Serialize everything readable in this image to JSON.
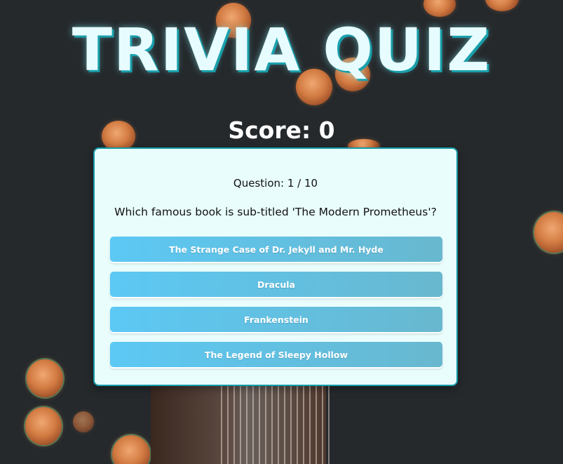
{
  "title": "TRIVIA QUIZ",
  "score": {
    "label": "Score: 0",
    "value": 0
  },
  "question": {
    "counter": "Question: 1 / 10",
    "current": 1,
    "total": 10,
    "text": "Which famous book is sub-titled 'The Modern Prometheus'?"
  },
  "answers": [
    {
      "label": "The Strange Case of Dr. Jekyll and Mr. Hyde"
    },
    {
      "label": "Dracula"
    },
    {
      "label": "Frankenstein"
    },
    {
      "label": "The Legend of Sleepy Hollow"
    }
  ],
  "colors": {
    "background": "#25292c",
    "title_text": "#e6fcff",
    "title_shadow": "#19a0ac",
    "card_background": "#e9fdfd",
    "card_border": "#149aa6",
    "answer_gradient_start": "#5cc8f4",
    "answer_gradient_end": "#68b8cf"
  }
}
